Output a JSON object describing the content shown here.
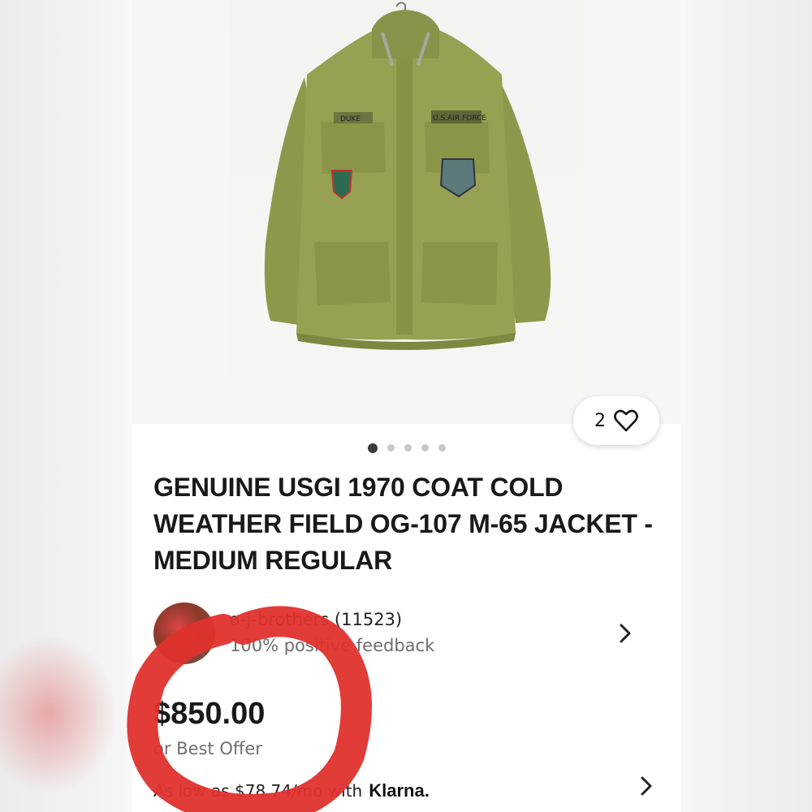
{
  "listing": {
    "favorite_count": "2",
    "image_count": 5,
    "active_image_index": 0,
    "title": "GENUINE USGI 1970 COAT COLD WEATHER FIELD OG-107 M-65 JACKET - MEDIUM REGULAR",
    "photo_labels": {
      "name_tape": "DUKE",
      "branch_tape": "U.S.AIR FORCE"
    }
  },
  "seller": {
    "name_with_score": "a-j-brothers (11523)",
    "feedback": "100% positive feedback"
  },
  "pricing": {
    "price": "$850.00",
    "offer_text": "or Best Offer",
    "financing_text": "As low as $78.74/mo with",
    "financing_brand": "Klarna."
  },
  "icons": {
    "favorite": "heart-icon",
    "seller_chevron": "chevron-right-icon",
    "financing_chevron": "chevron-right-icon"
  },
  "colors": {
    "annotation_red": "#e0322d",
    "jacket_olive": "#8f9a4a"
  }
}
